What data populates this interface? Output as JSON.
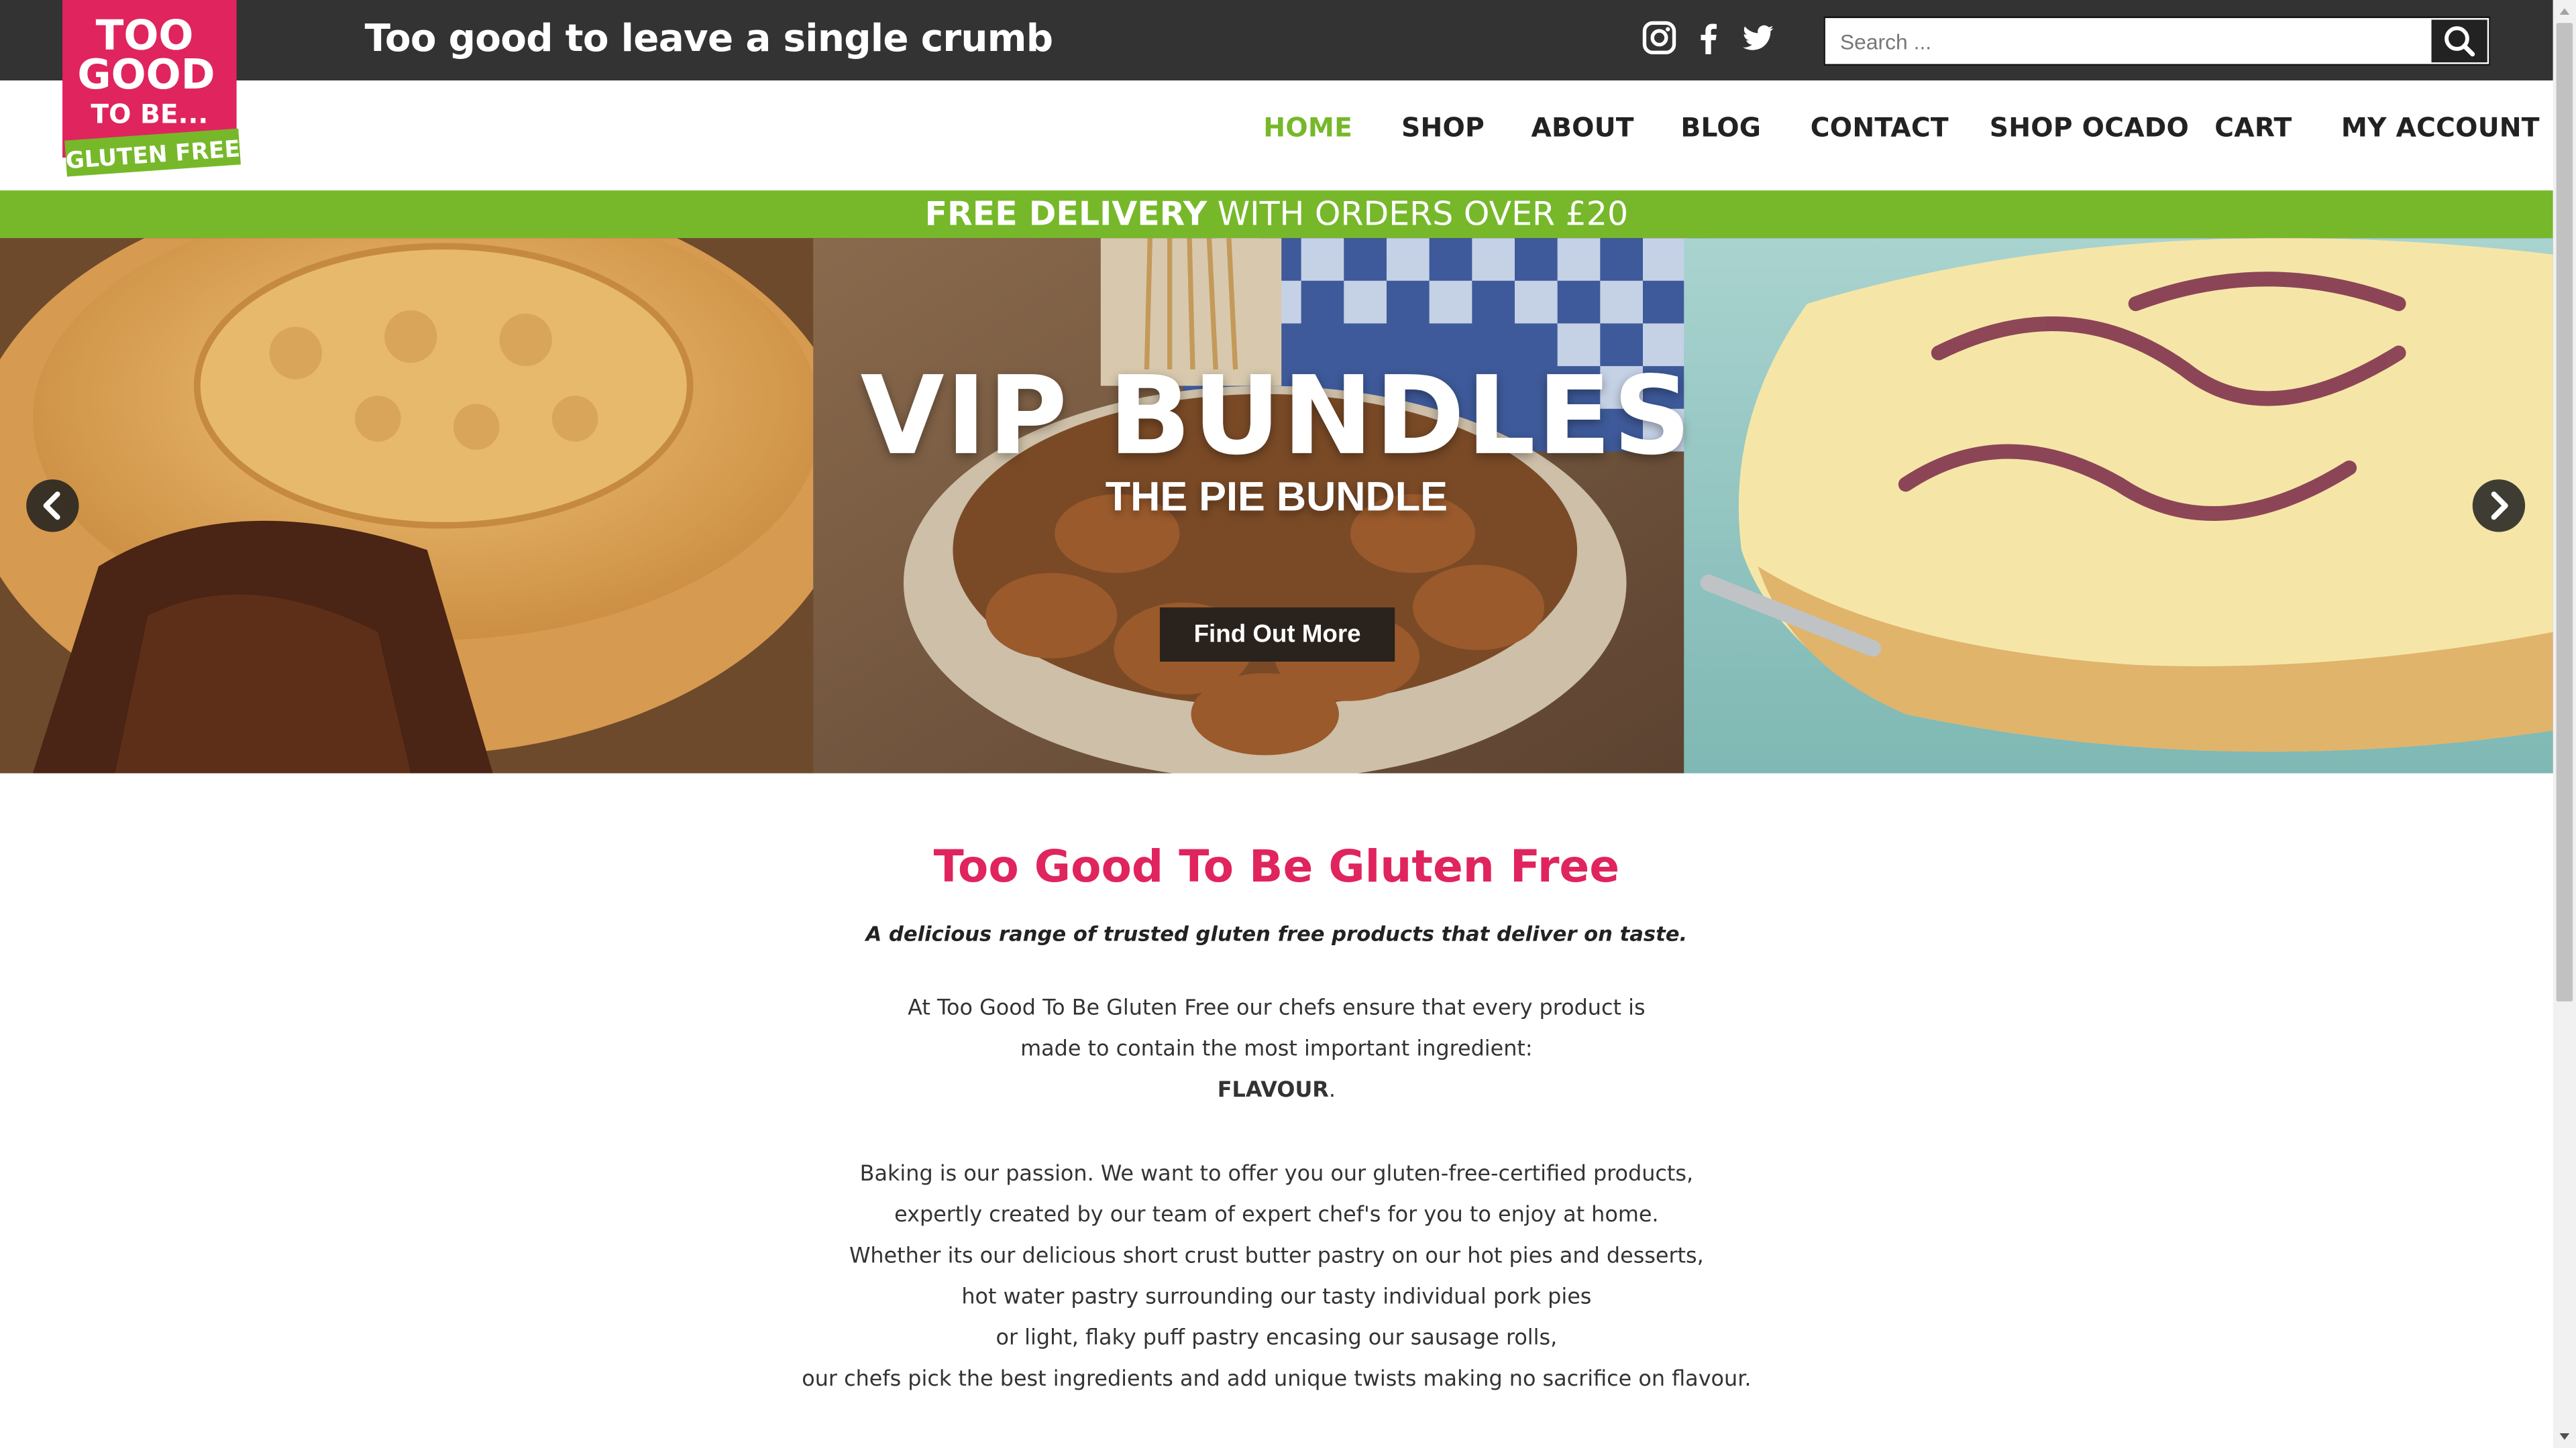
{
  "header": {
    "tagline": "Too good to leave a single crumb",
    "search_placeholder": "Search ..."
  },
  "logo": {
    "line1": "TOO",
    "line2": "GOOD",
    "line3": "TO BE...",
    "line4": "GLUTEN FREE"
  },
  "social": [
    "instagram-icon",
    "facebook-icon",
    "twitter-icon"
  ],
  "nav": {
    "home": "HOME",
    "shop": "SHOP",
    "about": "ABOUT",
    "blog": "BLOG",
    "contact": "CONTACT",
    "shop_ocado": "SHOP OCADO",
    "cart": "CART",
    "my_account": "MY ACCOUNT"
  },
  "delivery": {
    "bold": "FREE DELIVERY",
    "rest": " WITH ORDERS OVER £20"
  },
  "hero": {
    "title": "VIP BUNDLES",
    "subtitle": "THE PIE BUNDLE",
    "button": "Find Out More"
  },
  "main": {
    "heading": "Too Good To Be Gluten Free",
    "lead": "A delicious range of trusted gluten free products that deliver on taste.",
    "p1_l1": "At Too Good To Be Gluten Free our chefs ensure that every product is",
    "p1_l2": "made to contain the most important ingredient:",
    "p1_l3_bold": "FLAVOUR",
    "p1_l3_end": ".",
    "p2": [
      "Baking is our passion. We want to offer you our gluten-free-certified products,",
      "expertly created by our team of expert chef's for you to enjoy at home.",
      "Whether its our delicious short crust butter pastry on our hot pies and desserts,",
      "hot water pastry surrounding our tasty individual pork pies",
      "or light, flaky puff pastry encasing our sausage rolls,",
      "our chefs pick the best ingredients and add unique twists making no sacrifice on flavour."
    ]
  },
  "colors": {
    "accent_green": "#76b82a",
    "brand_pink": "#e0245e",
    "topbar": "#333333"
  }
}
